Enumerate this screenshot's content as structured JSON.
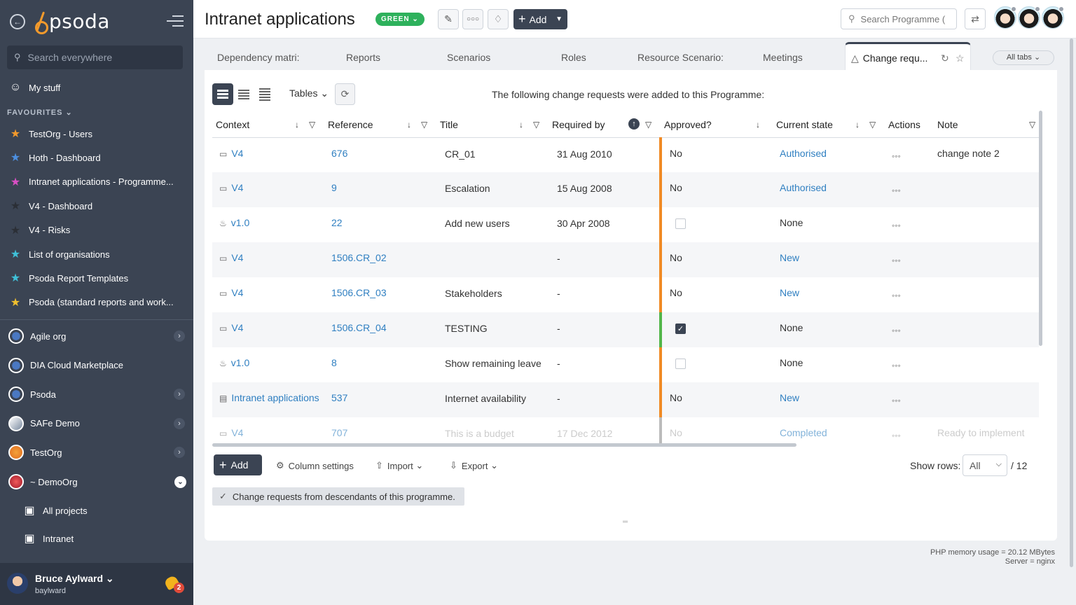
{
  "sidebar": {
    "brand": "psoda",
    "search_placeholder": "Search everywhere",
    "my_stuff": "My stuff",
    "favourites_label": "FAVOURITES",
    "favourites": [
      {
        "label": "TestOrg - Users",
        "color": "#f39a2c"
      },
      {
        "label": "Hoth - Dashboard",
        "color": "#4c8fe0"
      },
      {
        "label": "Intranet applications - Programme...",
        "color": "#d94fc4"
      },
      {
        "label": "V4 - Dashboard",
        "color": "#2b2f36"
      },
      {
        "label": "V4 - Risks",
        "color": "#2b2f36"
      },
      {
        "label": "List of organisations",
        "color": "#3fc0d8"
      },
      {
        "label": "Psoda Report Templates",
        "color": "#3fc0d8"
      },
      {
        "label": "Psoda (standard reports and work...",
        "color": "#f2c12e"
      }
    ],
    "orgs": [
      {
        "label": "Agile org",
        "expand": "more"
      },
      {
        "label": "DIA Cloud Marketplace",
        "expand": ""
      },
      {
        "label": "Psoda",
        "expand": "more"
      },
      {
        "label": "SAFe Demo",
        "expand": "more"
      },
      {
        "label": "TestOrg",
        "expand": "more"
      },
      {
        "label": "~ DemoOrg",
        "expand": "open"
      }
    ],
    "sub_items": [
      "All projects",
      "Intranet"
    ],
    "user": {
      "name": "Bruce Aylward",
      "login": "baylward",
      "notifications": "2"
    }
  },
  "header": {
    "title": "Intranet applications",
    "status": "GREEN",
    "add_label": "Add",
    "search_placeholder": "Search Programme (",
    "accent": "#3b4453",
    "status_color": "#2eb15c"
  },
  "tabs": {
    "items": [
      "Dependency matri:",
      "Reports",
      "Scenarios",
      "Roles",
      "Resource Scenario:",
      "Meetings"
    ],
    "active": "Change requ...",
    "all_tabs": "All tabs"
  },
  "panel": {
    "tables_label": "Tables",
    "caption": "The following change requests were added to this Programme:",
    "columns": [
      "Context",
      "Reference",
      "Title",
      "Required by",
      "Approved?",
      "Current state",
      "Actions",
      "Note"
    ],
    "rows": [
      {
        "context": "V4",
        "ctx_icon": "project-icon",
        "reference": "676",
        "title": "CR_01",
        "required_by": "31 Aug 2010",
        "approved": "No",
        "state": "Authorised",
        "state_link": true,
        "note": "change note 2",
        "bar": "orange"
      },
      {
        "context": "V4",
        "ctx_icon": "project-icon",
        "reference": "9",
        "title": "Escalation",
        "required_by": "15 Aug 2008",
        "approved": "No",
        "state": "Authorised",
        "state_link": true,
        "note": "",
        "bar": "orange"
      },
      {
        "context": "v1.0",
        "ctx_icon": "release-icon",
        "reference": "22",
        "title": "Add new users",
        "required_by": "30 Apr 2008",
        "approved": "checkbox",
        "state": "None",
        "state_link": false,
        "note": "",
        "bar": "orange"
      },
      {
        "context": "V4",
        "ctx_icon": "project-icon",
        "reference": "1506.CR_02",
        "title": "",
        "required_by": "-",
        "approved": "No",
        "state": "New",
        "state_link": true,
        "note": "",
        "bar": "orange"
      },
      {
        "context": "V4",
        "ctx_icon": "project-icon",
        "reference": "1506.CR_03",
        "title": "Stakeholders",
        "required_by": "-",
        "approved": "No",
        "state": "New",
        "state_link": true,
        "note": "",
        "bar": "orange"
      },
      {
        "context": "V4",
        "ctx_icon": "project-icon",
        "reference": "1506.CR_04",
        "title": "TESTING",
        "required_by": "-",
        "approved": "checked",
        "state": "None",
        "state_link": false,
        "note": "",
        "bar": "green"
      },
      {
        "context": "v1.0",
        "ctx_icon": "release-icon",
        "reference": "8",
        "title": "Show remaining leave",
        "required_by": "-",
        "approved": "checkbox",
        "state": "None",
        "state_link": false,
        "note": "",
        "bar": "orange"
      },
      {
        "context": "Intranet applications",
        "ctx_icon": "programme-icon",
        "reference": "537",
        "title": "Internet availability",
        "required_by": "-",
        "approved": "No",
        "state": "New",
        "state_link": true,
        "note": "",
        "bar": "orange"
      },
      {
        "context": "V4",
        "ctx_icon": "project-icon",
        "reference": "707",
        "title": "This is a budget",
        "required_by": "17 Dec 2012",
        "approved": "No",
        "state": "Completed",
        "state_link": true,
        "note": "Ready to implement",
        "bar": "grey"
      }
    ],
    "add_label": "Add",
    "column_settings": "Column settings",
    "import": "Import",
    "export": "Export",
    "show_rows_label": "Show rows:",
    "show_rows_value": "All",
    "total": "/ 12",
    "descendants": "Change requests from descendants of this programme."
  },
  "footer": {
    "memory": "PHP memory usage = 20.12 MBytes",
    "server": "Server = nginx"
  }
}
